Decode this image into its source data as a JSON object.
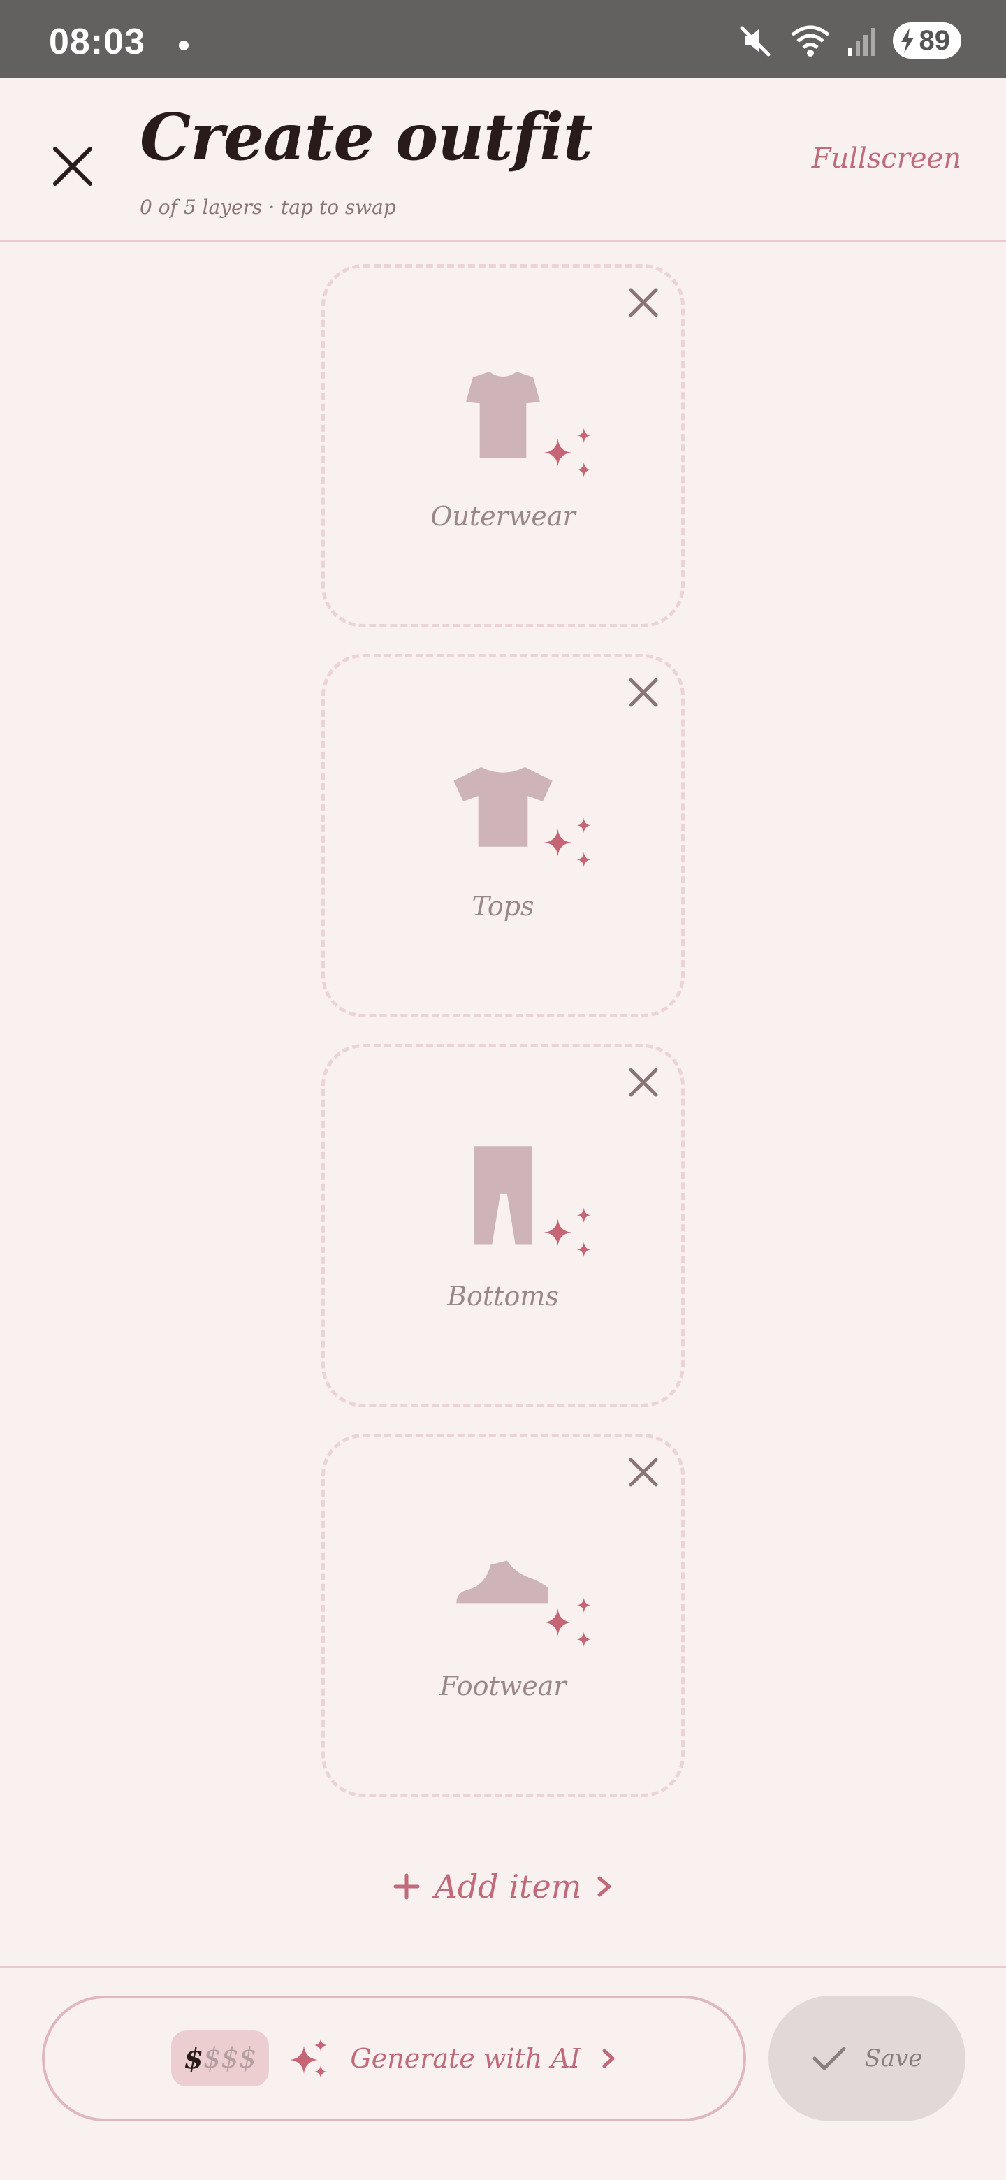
{
  "status_bar": {
    "time": "08:03",
    "battery": "89",
    "icons": [
      "mute-icon",
      "wifi-icon",
      "signal-icon",
      "battery-charging-icon"
    ]
  },
  "header": {
    "title": "Create outfit",
    "subtitle": "0 of 5 layers · tap to swap",
    "fullscreen_label": "Fullscreen"
  },
  "layers": [
    {
      "label": "Outerwear",
      "icon": "jacket-icon"
    },
    {
      "label": "Tops",
      "icon": "tshirt-icon"
    },
    {
      "label": "Bottoms",
      "icon": "pants-icon"
    },
    {
      "label": "Footwear",
      "icon": "shoe-icon"
    }
  ],
  "add_item_label": "Add item",
  "bottom_bar": {
    "price_active": "$",
    "price_inactive": "$$$",
    "generate_label": "Generate with AI",
    "save_label": "Save"
  },
  "colors": {
    "background": "#f9f0f0",
    "accent": "#c06a7a",
    "placeholder_icon": "#ceb4b8",
    "dashed_border": "#ecd3d5"
  }
}
